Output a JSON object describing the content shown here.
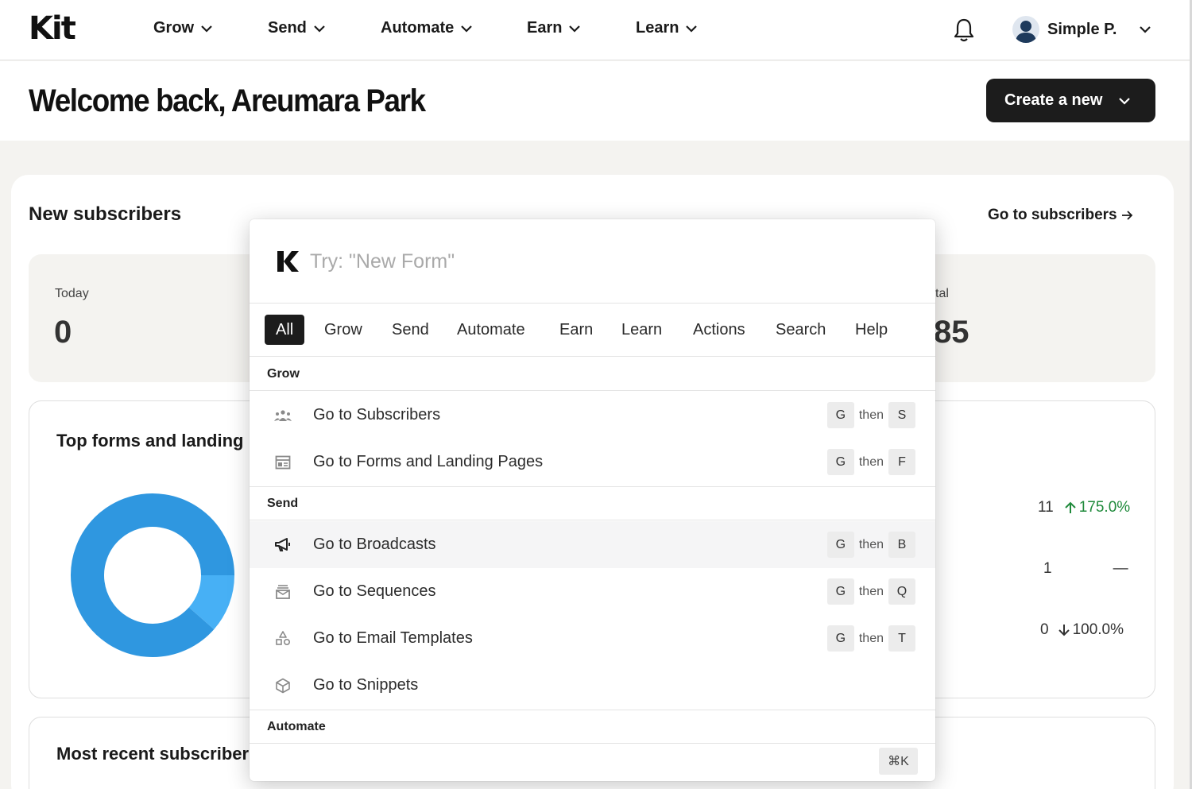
{
  "brand": {
    "logo": "Kit"
  },
  "nav": {
    "items": [
      {
        "label": "Grow"
      },
      {
        "label": "Send"
      },
      {
        "label": "Automate"
      },
      {
        "label": "Earn"
      },
      {
        "label": "Learn"
      }
    ],
    "user_name": "Simple P."
  },
  "header": {
    "welcome": "Welcome back, Areumara Park",
    "create_button": "Create a new"
  },
  "dashboard": {
    "new_subscribers_title": "New subscribers",
    "go_to_subscribers": "Go to subscribers",
    "stats": {
      "today_label": "Today",
      "today_value": "0",
      "total_label_partial": "tal",
      "total_value_partial": "85"
    },
    "top_forms_title": "Top forms and landing",
    "top_forms_rows": [
      {
        "count": "11",
        "change": "175.0%",
        "direction": "up"
      },
      {
        "count": "1",
        "change": "—",
        "direction": "none"
      },
      {
        "count": "0",
        "change": "100.0%",
        "direction": "down"
      }
    ],
    "donut": {
      "slices": [
        {
          "value": 88.5,
          "color": "#2f97e0"
        },
        {
          "value": 11.5,
          "color": "#47b0f5"
        }
      ]
    },
    "recent_title": "Most recent subscriber"
  },
  "palette": {
    "placeholder": "Try: \"New Form\"",
    "tabs": [
      {
        "label": "All",
        "active": true
      },
      {
        "label": "Grow"
      },
      {
        "label": "Send"
      },
      {
        "label": "Automate"
      },
      {
        "label": "Earn"
      },
      {
        "label": "Learn"
      },
      {
        "label": "Actions"
      },
      {
        "label": "Search"
      },
      {
        "label": "Help"
      }
    ],
    "sections": {
      "grow": "Grow",
      "send": "Send",
      "automate": "Automate"
    },
    "items": [
      {
        "label": "Go to Subscribers",
        "key1": "G",
        "then": "then",
        "key2": "S",
        "icon": "subscribers-icon"
      },
      {
        "label": "Go to Forms and Landing Pages",
        "key1": "G",
        "then": "then",
        "key2": "F",
        "icon": "forms-icon"
      },
      {
        "label": "Go to Broadcasts",
        "key1": "G",
        "then": "then",
        "key2": "B",
        "icon": "megaphone-icon"
      },
      {
        "label": "Go to Sequences",
        "key1": "G",
        "then": "then",
        "key2": "Q",
        "icon": "sequences-icon"
      },
      {
        "label": "Go to Email Templates",
        "key1": "G",
        "then": "then",
        "key2": "T",
        "icon": "shapes-icon"
      },
      {
        "label": "Go to Snippets",
        "icon": "cube-icon"
      }
    ],
    "shortcut_hint": "⌘K"
  },
  "colors": {
    "accent_dark": "#1c1c1c",
    "up_green": "#1f8a3b",
    "donut_primary": "#2f97e0",
    "donut_secondary": "#47b0f5"
  }
}
